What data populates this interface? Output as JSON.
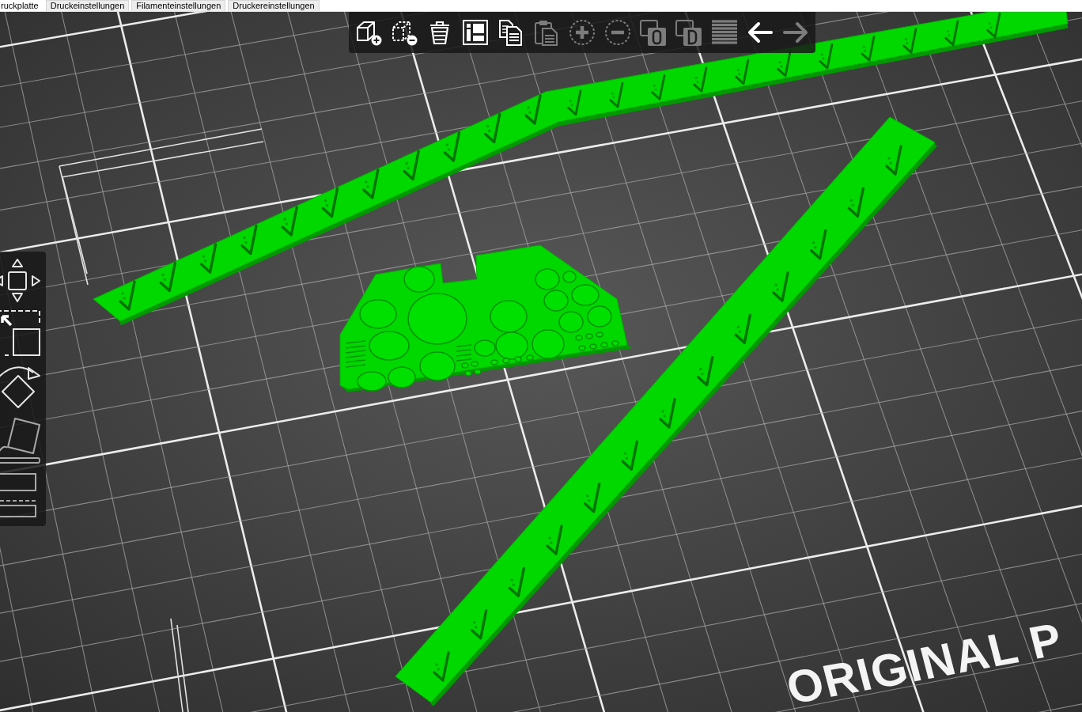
{
  "tabs": [
    {
      "label": "ruckplatte",
      "selected": true
    },
    {
      "label": "Druckeinstellungen",
      "selected": false
    },
    {
      "label": "Filamenteinstellungen",
      "selected": false
    },
    {
      "label": "Druckereinstellungen",
      "selected": false
    }
  ],
  "toolbar": {
    "items": [
      {
        "kind": "add",
        "disabled": false
      },
      {
        "kind": "delete",
        "disabled": false
      },
      {
        "kind": "delete-all",
        "disabled": false
      },
      {
        "kind": "arrange",
        "disabled": false
      },
      {
        "kind": "copy",
        "disabled": false
      },
      {
        "kind": "paste",
        "disabled": true
      },
      {
        "kind": "instance-add",
        "disabled": true
      },
      {
        "kind": "instance-remove",
        "disabled": true
      },
      {
        "kind": "split-objects",
        "disabled": true
      },
      {
        "kind": "split-parts",
        "disabled": true
      },
      {
        "kind": "layers",
        "disabled": true
      },
      {
        "kind": "undo",
        "disabled": false
      },
      {
        "kind": "redo",
        "disabled": true
      }
    ]
  },
  "gizmos": [
    {
      "kind": "move"
    },
    {
      "kind": "scale"
    },
    {
      "kind": "rotate"
    },
    {
      "kind": "place"
    },
    {
      "kind": "cut"
    }
  ],
  "scene": {
    "bed_label": "ORIGINAL P",
    "objects": [
      {
        "kind": "bent-strip"
      },
      {
        "kind": "panel"
      },
      {
        "kind": "straight-strip"
      }
    ]
  }
}
